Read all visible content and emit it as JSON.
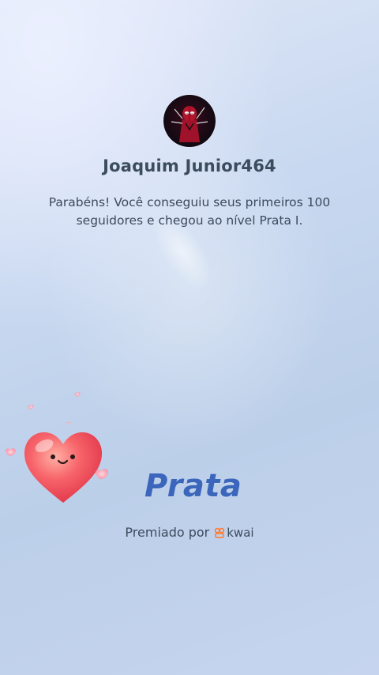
{
  "profile": {
    "username": "Joaquim Junior464",
    "avatar_icon": "spider-man-avatar"
  },
  "achievement": {
    "message": "Parabéns! Você conseguiu seus primeiros 100 seguidores e chegou ao nível Prata I.",
    "level_name": "Prata",
    "badge_icon": "smiling-heart-icon"
  },
  "footer": {
    "awarded_by": "Premiado por",
    "brand": "kwai",
    "brand_icon": "kwai-logo-icon",
    "brand_color": "#ff7a2f"
  },
  "colors": {
    "level_text": "#3b66bb",
    "heart": "#f2575e"
  }
}
